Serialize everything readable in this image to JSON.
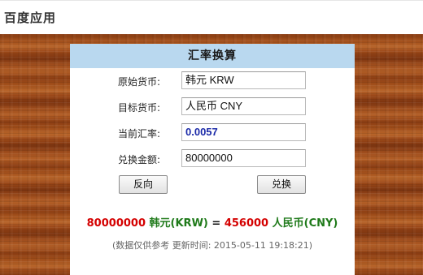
{
  "app_title": "百度应用",
  "converter": {
    "title": "汇率换算",
    "fields": [
      {
        "label": "原始货币:",
        "value": "韩元 KRW"
      },
      {
        "label": "目标货币:",
        "value": "人民币 CNY"
      },
      {
        "label": "当前汇率:",
        "value": "0.0057"
      },
      {
        "label": "兑换金额:",
        "value": "80000000"
      }
    ],
    "reverse_button": "反向",
    "convert_button": "兑换",
    "result": {
      "from_amount": "80000000",
      "from_currency": "韩元(KRW)",
      "equals": "=",
      "to_amount": "456000",
      "to_currency": "人民币(CNY)"
    },
    "note": "(数据仅供参考 更新时间: 2015-05-11 19:18:21)"
  },
  "colors": {
    "header_band": "#b9d8ef",
    "amount_red": "#d40000",
    "currency_green": "#1f7a1a",
    "rate_blue": "#1b2aa8"
  }
}
